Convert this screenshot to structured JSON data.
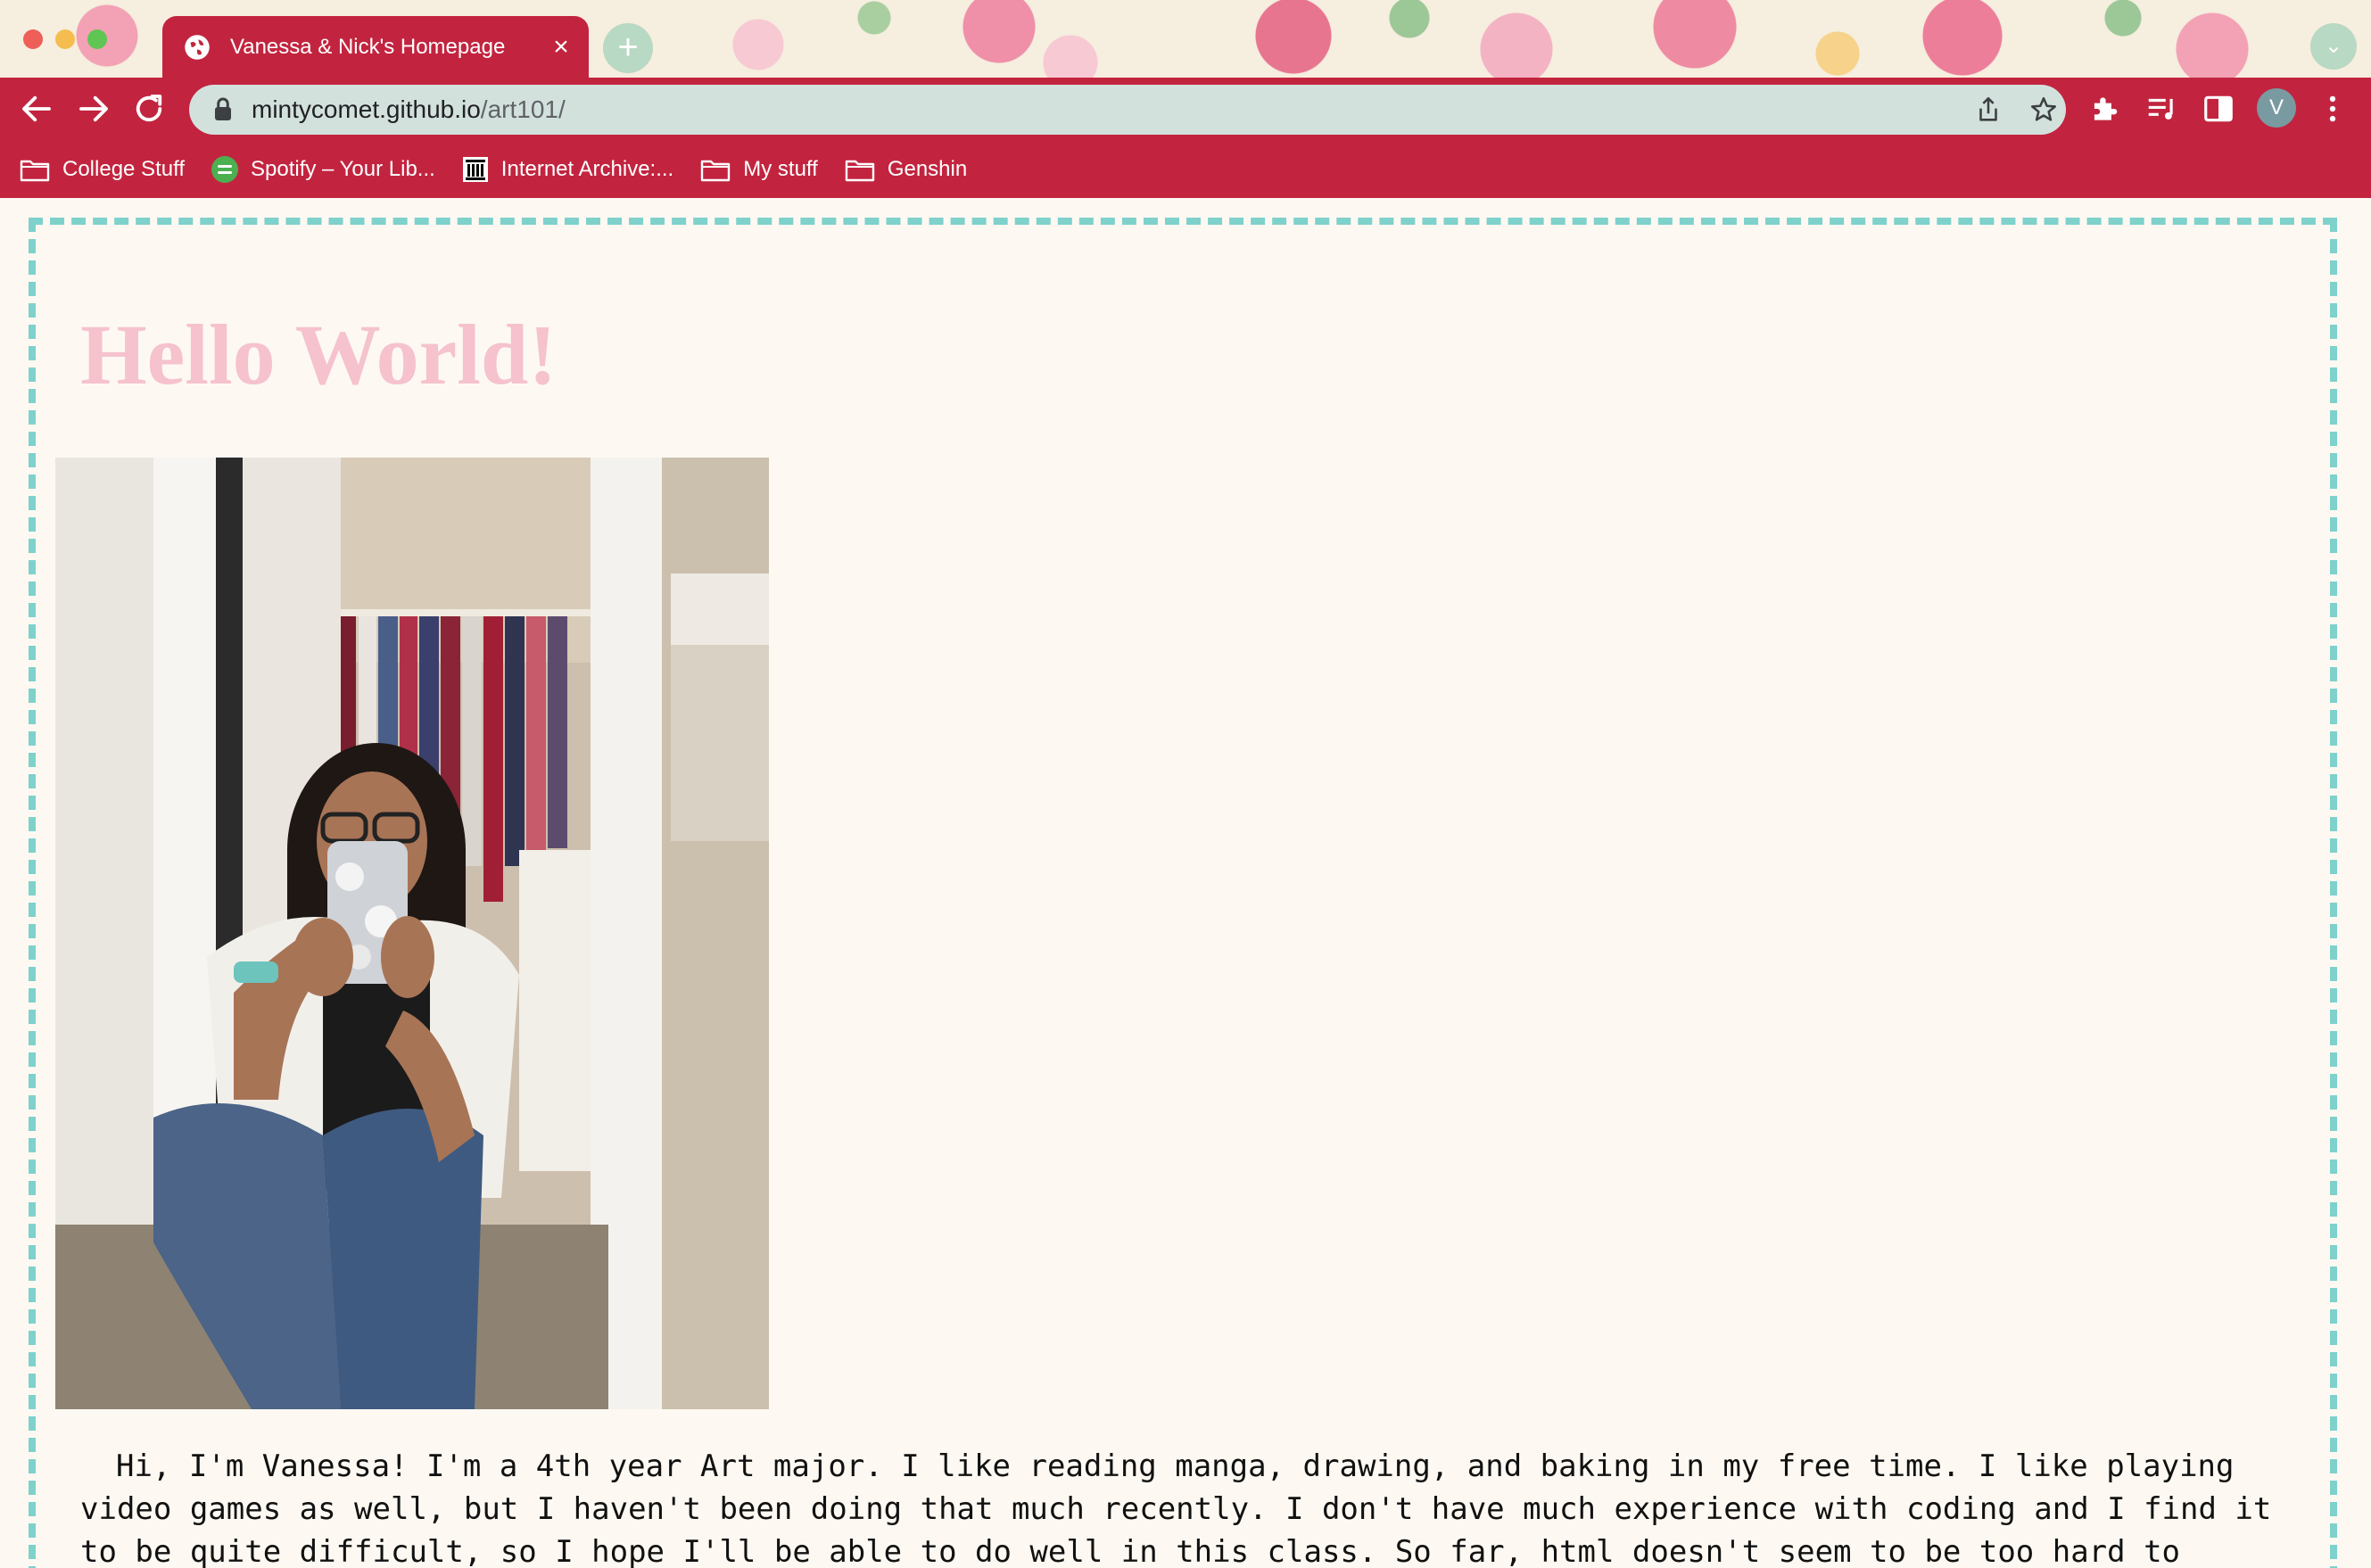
{
  "browser": {
    "tab_title": "Vanessa & Nick's Homepage",
    "tab_close": "×",
    "new_tab": "+",
    "tab_search": "⌄",
    "url_host": "mintycomet.github.io",
    "url_path": "/art101/",
    "profile_initial": "V",
    "bookmarks": [
      {
        "label": "College Stuff",
        "icon": "folder-icon"
      },
      {
        "label": "Spotify – Your Lib...",
        "icon": "spotify-icon"
      },
      {
        "label": "Internet Archive:...",
        "icon": "archive-icon"
      },
      {
        "label": "My stuff",
        "icon": "folder-icon"
      },
      {
        "label": "Genshin",
        "icon": "folder-icon"
      }
    ],
    "accent_color": "#c2243f",
    "omnibox_color": "#d3e1dc"
  },
  "page": {
    "heading": "Hello World!",
    "heading_color": "#f5c2cd",
    "border_color": "#7fd1cb",
    "intro": "Hi, I'm Vanessa! I'm a 4th year Art major. I like reading manga, drawing, and baking in my free time. I like playing video games as well, but I haven't been doing that much recently. I don't have much experience with coding and I find it to be quite difficult, so I hope I'll be able to do well in this class. So far, html doesn't seem to be too hard to understand, so I hope I"
  }
}
